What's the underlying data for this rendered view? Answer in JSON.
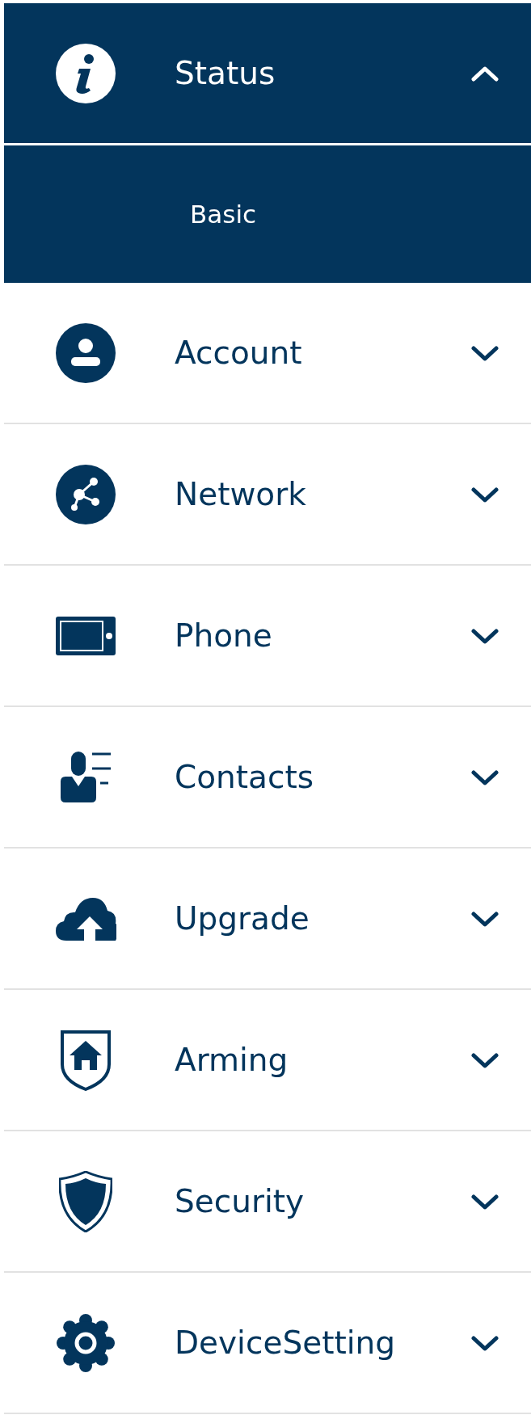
{
  "menu": [
    {
      "label": "Status",
      "kind": "info",
      "expanded": true,
      "children": [
        {
          "label": "Basic"
        }
      ]
    },
    {
      "label": "Account",
      "kind": "user",
      "expanded": false
    },
    {
      "label": "Network",
      "kind": "share",
      "expanded": false
    },
    {
      "label": "Phone",
      "kind": "tablet",
      "expanded": false
    },
    {
      "label": "Contacts",
      "kind": "contacts",
      "expanded": false
    },
    {
      "label": "Upgrade",
      "kind": "upload",
      "expanded": false
    },
    {
      "label": "Arming",
      "kind": "home",
      "expanded": false
    },
    {
      "label": "Security",
      "kind": "shield",
      "expanded": false
    },
    {
      "label": "DeviceSetting",
      "kind": "gear",
      "expanded": false
    }
  ]
}
